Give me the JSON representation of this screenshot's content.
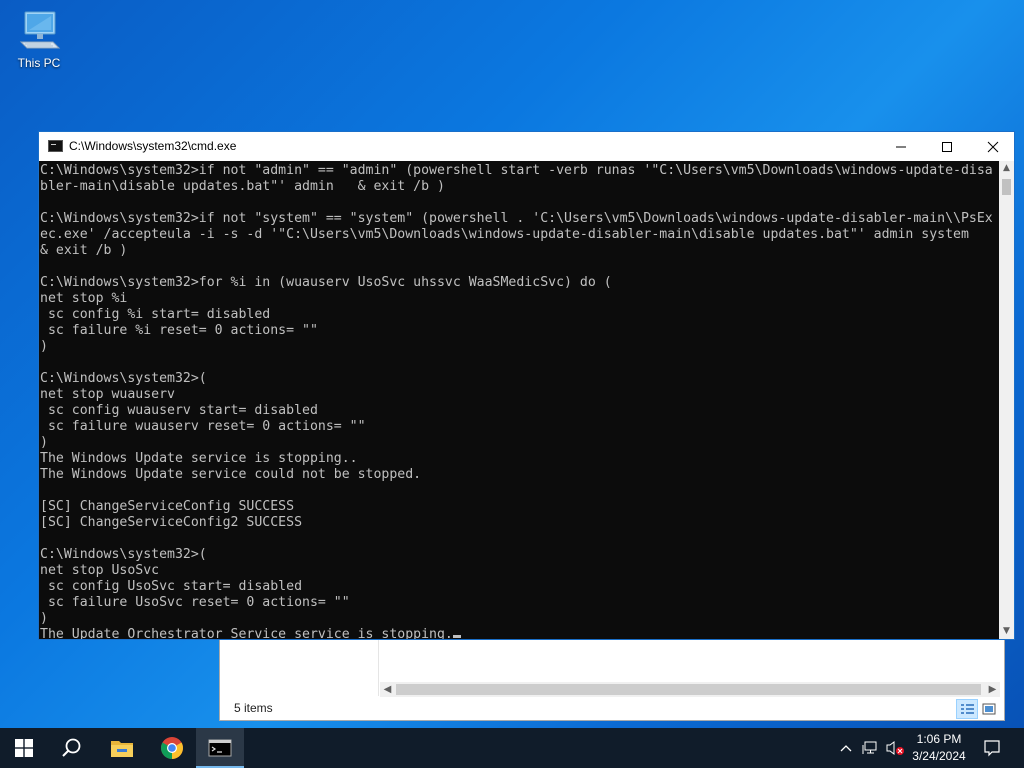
{
  "desktop": {
    "icons": [
      {
        "label": "This PC",
        "icon": "computer-icon"
      }
    ]
  },
  "explorer": {
    "status_items": "5 items"
  },
  "cmd": {
    "title": "C:\\Windows\\system32\\cmd.exe",
    "lines": [
      "C:\\Windows\\system32>if not \"admin\" == \"admin\" (powershell start -verb runas '\"C:\\Users\\vm5\\Downloads\\windows-update-disa",
      "bler-main\\disable updates.bat\"' admin   & exit /b )",
      "",
      "C:\\Windows\\system32>if not \"system\" == \"system\" (powershell . 'C:\\Users\\vm5\\Downloads\\windows-update-disabler-main\\\\PsEx",
      "ec.exe' /accepteula -i -s -d '\"C:\\Users\\vm5\\Downloads\\windows-update-disabler-main\\disable updates.bat\"' admin system",
      "& exit /b )",
      "",
      "C:\\Windows\\system32>for %i in (wuauserv UsoSvc uhssvc WaaSMedicSvc) do (",
      "net stop %i",
      " sc config %i start= disabled",
      " sc failure %i reset= 0 actions= \"\"",
      ")",
      "",
      "C:\\Windows\\system32>(",
      "net stop wuauserv",
      " sc config wuauserv start= disabled",
      " sc failure wuauserv reset= 0 actions= \"\"",
      ")",
      "The Windows Update service is stopping..",
      "The Windows Update service could not be stopped.",
      "",
      "[SC] ChangeServiceConfig SUCCESS",
      "[SC] ChangeServiceConfig2 SUCCESS",
      "",
      "C:\\Windows\\system32>(",
      "net stop UsoSvc",
      " sc config UsoSvc start= disabled",
      " sc failure UsoSvc reset= 0 actions= \"\"",
      ")",
      "The Update Orchestrator Service service is stopping."
    ]
  },
  "taskbar": {
    "apps": [
      {
        "name": "search",
        "icon": "search-icon"
      },
      {
        "name": "file-explorer",
        "icon": "folder-icon"
      },
      {
        "name": "chrome",
        "icon": "chrome-icon"
      },
      {
        "name": "cmd",
        "icon": "cmd-icon"
      }
    ],
    "clock": {
      "time": "1:06 PM",
      "date": "3/24/2024"
    }
  },
  "colors": {
    "console_bg": "#0c0c0c",
    "console_fg": "#c0c0c0",
    "taskbar": "#101c2a",
    "accent": "#76b9ed"
  }
}
